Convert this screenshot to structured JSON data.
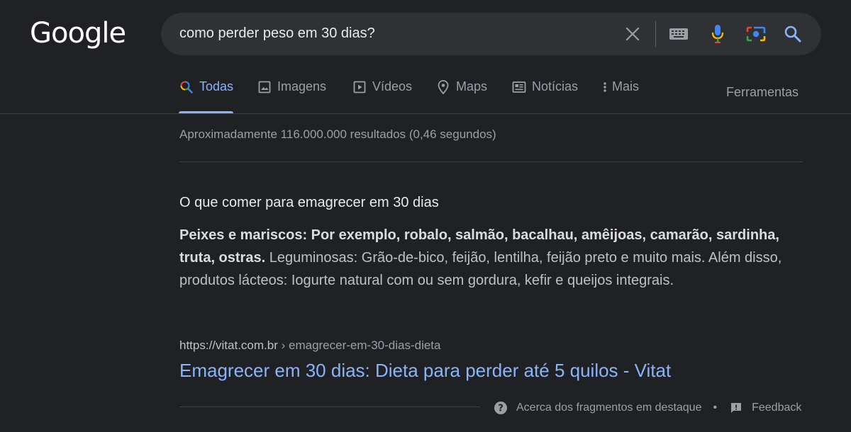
{
  "header": {
    "logo_text": "Google",
    "search_query": "como perder peso em 30 dias?",
    "icons": [
      "close-icon",
      "keyboard-icon",
      "mic-icon",
      "camera-icon",
      "search-icon"
    ]
  },
  "tabs": [
    {
      "label": "Todas",
      "icon": "search-icon",
      "active": true
    },
    {
      "label": "Imagens",
      "icon": "image-icon"
    },
    {
      "label": "Vídeos",
      "icon": "play-icon"
    },
    {
      "label": "Maps",
      "icon": "pin-icon"
    },
    {
      "label": "Notícias",
      "icon": "news-icon"
    },
    {
      "label": "Mais",
      "icon": "more-vert-icon"
    }
  ],
  "tools_label": "Ferramentas",
  "result_stats": "Aproximadamente 116.000.000 resultados (0,46 segundos)",
  "snippet": {
    "title": "O que comer para emagrecer em 30 dias",
    "bold_text": "Peixes e mariscos: Por exemplo, robalo, salmão, bacalhau, amêijoas, camarão, sardinha, truta, ostras.",
    "body_text": " Leguminosas: Grão-de-bico, feijão, lentilha, feijão preto e muito mais. Além disso, produtos lácteos: Iogurte natural com ou sem gordura, kefir e queijos integrais.",
    "cite_domain": "https://vitat.com.br",
    "cite_path": " › emagrecer-em-30-dias-dieta",
    "link_text": "Emagrecer em 30 dias: Dieta para perder até 5 quilos - Vitat"
  },
  "footer": {
    "about_label": "Acerca dos fragmentos em destaque",
    "separator": "•",
    "feedback_label": "Feedback"
  },
  "colors": {
    "background": "#202124",
    "link": "#8ab4f8",
    "searchbar": "#303134"
  }
}
